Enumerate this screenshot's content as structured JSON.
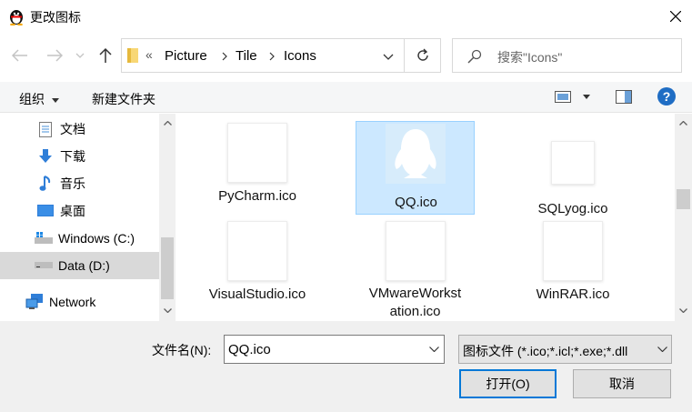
{
  "window": {
    "title": "更改图标",
    "close_icon": "close-icon"
  },
  "nav": {
    "breadcrumb_prefix": "«",
    "path": [
      "Picture",
      "Tile",
      "Icons"
    ],
    "search_placeholder": "搜索\"Icons\""
  },
  "toolbar": {
    "organize": "组织",
    "new_folder": "新建文件夹"
  },
  "sidebar": {
    "items": [
      {
        "label": "文档",
        "icon": "document-icon"
      },
      {
        "label": "下载",
        "icon": "download-icon"
      },
      {
        "label": "音乐",
        "icon": "music-icon"
      },
      {
        "label": "桌面",
        "icon": "desktop-icon"
      },
      {
        "label": "Windows (C:)",
        "icon": "drive-icon"
      },
      {
        "label": "Data (D:)",
        "icon": "drive-icon",
        "selected": true
      },
      {
        "label": "Network",
        "icon": "network-icon"
      }
    ]
  },
  "files": [
    {
      "name": "PyCharm.ico",
      "selected": false
    },
    {
      "name": "QQ.ico",
      "selected": true
    },
    {
      "name": "SQLyog.ico",
      "selected": false
    },
    {
      "name": "VisualStudio.ico",
      "selected": false
    },
    {
      "name_line1": "VMwareWorkst",
      "name_line2": "ation.ico",
      "selected": false
    },
    {
      "name": "WinRAR.ico",
      "selected": false
    }
  ],
  "bottom": {
    "filename_label": "文件名(N):",
    "filename_value": "QQ.ico",
    "filetype_value": "图标文件 (*.ico;*.icl;*.exe;*.dll",
    "open_button": "打开(O)",
    "cancel_button": "取消"
  },
  "colors": {
    "selection": "#cce8ff",
    "selection_border": "#99d1ff",
    "accent": "#0078d7"
  }
}
